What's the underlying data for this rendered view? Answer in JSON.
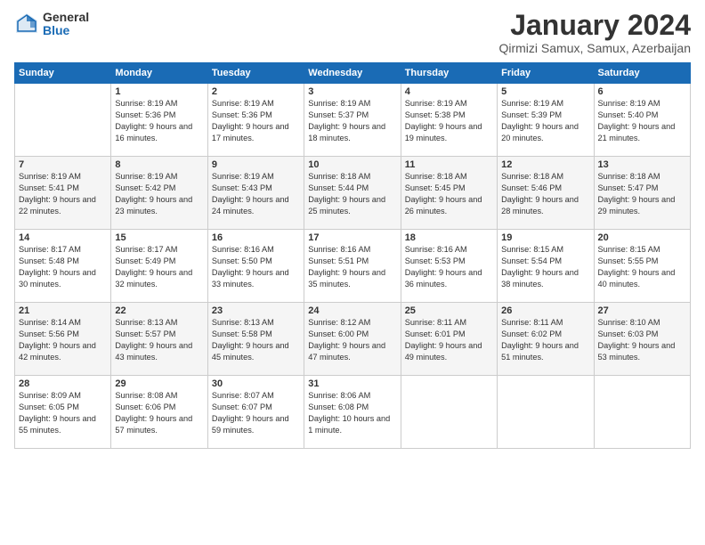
{
  "logo": {
    "general": "General",
    "blue": "Blue"
  },
  "title": "January 2024",
  "location": "Qirmizi Samux, Samux, Azerbaijan",
  "weekdays": [
    "Sunday",
    "Monday",
    "Tuesday",
    "Wednesday",
    "Thursday",
    "Friday",
    "Saturday"
  ],
  "weeks": [
    [
      {
        "day": "",
        "sunrise": "",
        "sunset": "",
        "daylight": ""
      },
      {
        "day": "1",
        "sunrise": "Sunrise: 8:19 AM",
        "sunset": "Sunset: 5:36 PM",
        "daylight": "Daylight: 9 hours and 16 minutes."
      },
      {
        "day": "2",
        "sunrise": "Sunrise: 8:19 AM",
        "sunset": "Sunset: 5:36 PM",
        "daylight": "Daylight: 9 hours and 17 minutes."
      },
      {
        "day": "3",
        "sunrise": "Sunrise: 8:19 AM",
        "sunset": "Sunset: 5:37 PM",
        "daylight": "Daylight: 9 hours and 18 minutes."
      },
      {
        "day": "4",
        "sunrise": "Sunrise: 8:19 AM",
        "sunset": "Sunset: 5:38 PM",
        "daylight": "Daylight: 9 hours and 19 minutes."
      },
      {
        "day": "5",
        "sunrise": "Sunrise: 8:19 AM",
        "sunset": "Sunset: 5:39 PM",
        "daylight": "Daylight: 9 hours and 20 minutes."
      },
      {
        "day": "6",
        "sunrise": "Sunrise: 8:19 AM",
        "sunset": "Sunset: 5:40 PM",
        "daylight": "Daylight: 9 hours and 21 minutes."
      }
    ],
    [
      {
        "day": "7",
        "sunrise": "Sunrise: 8:19 AM",
        "sunset": "Sunset: 5:41 PM",
        "daylight": "Daylight: 9 hours and 22 minutes."
      },
      {
        "day": "8",
        "sunrise": "Sunrise: 8:19 AM",
        "sunset": "Sunset: 5:42 PM",
        "daylight": "Daylight: 9 hours and 23 minutes."
      },
      {
        "day": "9",
        "sunrise": "Sunrise: 8:19 AM",
        "sunset": "Sunset: 5:43 PM",
        "daylight": "Daylight: 9 hours and 24 minutes."
      },
      {
        "day": "10",
        "sunrise": "Sunrise: 8:18 AM",
        "sunset": "Sunset: 5:44 PM",
        "daylight": "Daylight: 9 hours and 25 minutes."
      },
      {
        "day": "11",
        "sunrise": "Sunrise: 8:18 AM",
        "sunset": "Sunset: 5:45 PM",
        "daylight": "Daylight: 9 hours and 26 minutes."
      },
      {
        "day": "12",
        "sunrise": "Sunrise: 8:18 AM",
        "sunset": "Sunset: 5:46 PM",
        "daylight": "Daylight: 9 hours and 28 minutes."
      },
      {
        "day": "13",
        "sunrise": "Sunrise: 8:18 AM",
        "sunset": "Sunset: 5:47 PM",
        "daylight": "Daylight: 9 hours and 29 minutes."
      }
    ],
    [
      {
        "day": "14",
        "sunrise": "Sunrise: 8:17 AM",
        "sunset": "Sunset: 5:48 PM",
        "daylight": "Daylight: 9 hours and 30 minutes."
      },
      {
        "day": "15",
        "sunrise": "Sunrise: 8:17 AM",
        "sunset": "Sunset: 5:49 PM",
        "daylight": "Daylight: 9 hours and 32 minutes."
      },
      {
        "day": "16",
        "sunrise": "Sunrise: 8:16 AM",
        "sunset": "Sunset: 5:50 PM",
        "daylight": "Daylight: 9 hours and 33 minutes."
      },
      {
        "day": "17",
        "sunrise": "Sunrise: 8:16 AM",
        "sunset": "Sunset: 5:51 PM",
        "daylight": "Daylight: 9 hours and 35 minutes."
      },
      {
        "day": "18",
        "sunrise": "Sunrise: 8:16 AM",
        "sunset": "Sunset: 5:53 PM",
        "daylight": "Daylight: 9 hours and 36 minutes."
      },
      {
        "day": "19",
        "sunrise": "Sunrise: 8:15 AM",
        "sunset": "Sunset: 5:54 PM",
        "daylight": "Daylight: 9 hours and 38 minutes."
      },
      {
        "day": "20",
        "sunrise": "Sunrise: 8:15 AM",
        "sunset": "Sunset: 5:55 PM",
        "daylight": "Daylight: 9 hours and 40 minutes."
      }
    ],
    [
      {
        "day": "21",
        "sunrise": "Sunrise: 8:14 AM",
        "sunset": "Sunset: 5:56 PM",
        "daylight": "Daylight: 9 hours and 42 minutes."
      },
      {
        "day": "22",
        "sunrise": "Sunrise: 8:13 AM",
        "sunset": "Sunset: 5:57 PM",
        "daylight": "Daylight: 9 hours and 43 minutes."
      },
      {
        "day": "23",
        "sunrise": "Sunrise: 8:13 AM",
        "sunset": "Sunset: 5:58 PM",
        "daylight": "Daylight: 9 hours and 45 minutes."
      },
      {
        "day": "24",
        "sunrise": "Sunrise: 8:12 AM",
        "sunset": "Sunset: 6:00 PM",
        "daylight": "Daylight: 9 hours and 47 minutes."
      },
      {
        "day": "25",
        "sunrise": "Sunrise: 8:11 AM",
        "sunset": "Sunset: 6:01 PM",
        "daylight": "Daylight: 9 hours and 49 minutes."
      },
      {
        "day": "26",
        "sunrise": "Sunrise: 8:11 AM",
        "sunset": "Sunset: 6:02 PM",
        "daylight": "Daylight: 9 hours and 51 minutes."
      },
      {
        "day": "27",
        "sunrise": "Sunrise: 8:10 AM",
        "sunset": "Sunset: 6:03 PM",
        "daylight": "Daylight: 9 hours and 53 minutes."
      }
    ],
    [
      {
        "day": "28",
        "sunrise": "Sunrise: 8:09 AM",
        "sunset": "Sunset: 6:05 PM",
        "daylight": "Daylight: 9 hours and 55 minutes."
      },
      {
        "day": "29",
        "sunrise": "Sunrise: 8:08 AM",
        "sunset": "Sunset: 6:06 PM",
        "daylight": "Daylight: 9 hours and 57 minutes."
      },
      {
        "day": "30",
        "sunrise": "Sunrise: 8:07 AM",
        "sunset": "Sunset: 6:07 PM",
        "daylight": "Daylight: 9 hours and 59 minutes."
      },
      {
        "day": "31",
        "sunrise": "Sunrise: 8:06 AM",
        "sunset": "Sunset: 6:08 PM",
        "daylight": "Daylight: 10 hours and 1 minute."
      },
      {
        "day": "",
        "sunrise": "",
        "sunset": "",
        "daylight": ""
      },
      {
        "day": "",
        "sunrise": "",
        "sunset": "",
        "daylight": ""
      },
      {
        "day": "",
        "sunrise": "",
        "sunset": "",
        "daylight": ""
      }
    ]
  ]
}
